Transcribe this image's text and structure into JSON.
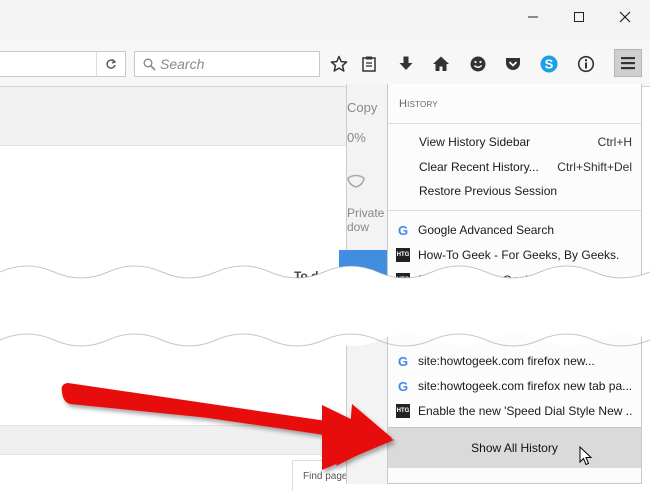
{
  "toolbar": {
    "search_placeholder": "Search"
  },
  "background": {
    "copy_label": "Copy",
    "zoom_label": "0%",
    "private_label_line1": "Private",
    "private_label_line2": "dow",
    "todo_text": "To do thi",
    "find_pages_text": "Find pages published in a particular region"
  },
  "history": {
    "heading": "History",
    "commands": [
      {
        "label": "View History Sidebar",
        "shortcut": "Ctrl+H"
      },
      {
        "label": "Clear Recent History...",
        "shortcut": "Ctrl+Shift+Del"
      },
      {
        "label": "Restore Previous Session",
        "shortcut": ""
      }
    ],
    "entries_top": [
      {
        "icon": "google-icon",
        "title": "Google Advanced Search"
      },
      {
        "icon": "htg-icon",
        "title": "How-To Geek - For Geeks, By Geeks."
      },
      {
        "icon": "htg-icon",
        "title": "Posts ‹ How-To Geek — WordPress"
      }
    ],
    "entries_bottom": [
      {
        "icon": "google-icon",
        "title": "site:howtogeek.com firefox new..."
      },
      {
        "icon": "google-icon",
        "title": "site:howtogeek.com firefox new tab pa..."
      },
      {
        "icon": "htg-icon",
        "title": "Enable the new 'Speed Dial Style New ..."
      }
    ],
    "show_all_label": "Show All History"
  },
  "colors": {
    "arrow": "#e8110f",
    "accent_blue": "#3f8ee0"
  }
}
